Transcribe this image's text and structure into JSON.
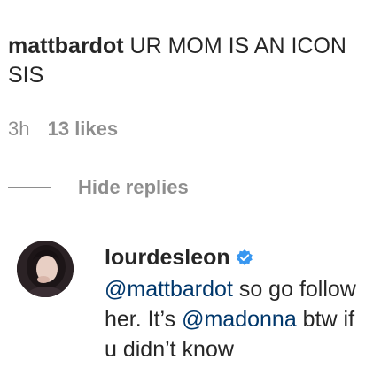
{
  "comment": {
    "username": "mattbardot",
    "text_line1": "UR MOM IS AN ICON",
    "text_line2": "SIS",
    "time": "3h",
    "likes": "13 likes"
  },
  "replies_toggle": {
    "label": "Hide replies"
  },
  "reply": {
    "username": "lourdesleon",
    "verified_icon": "verified-badge-icon",
    "mention1": "@mattbardot",
    "text_a": " so go follow",
    "text_b": "her. It’s ",
    "mention2": "@madonna",
    "text_c": " btw if",
    "text_d": "u didn’t know"
  },
  "colors": {
    "text": "#262626",
    "muted": "#8e8e8e",
    "mention": "#00376b",
    "verified": "#3897f0"
  }
}
